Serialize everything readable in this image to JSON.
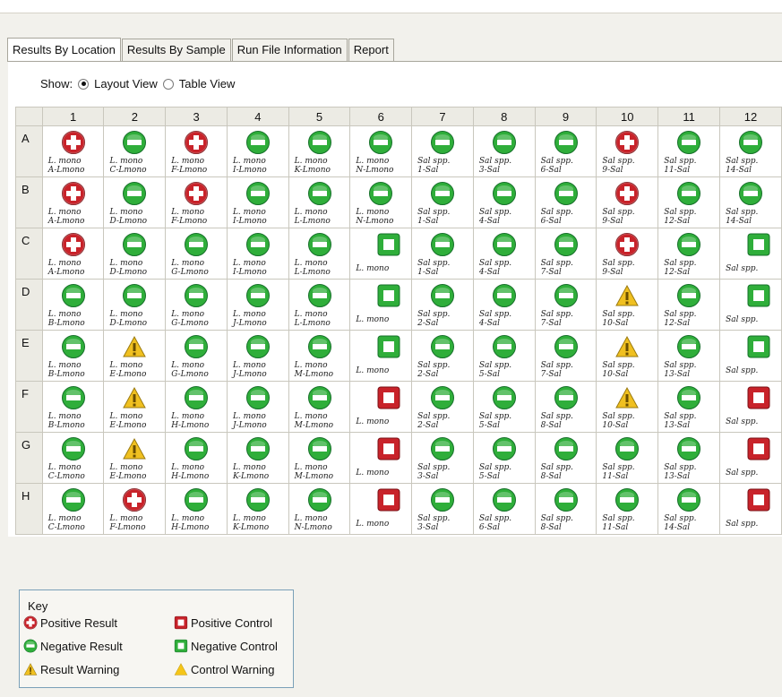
{
  "tabs": [
    "Results By Location",
    "Results By Sample",
    "Run File Information",
    "Report"
  ],
  "show": {
    "label": "Show:",
    "layout_view": "Layout View",
    "table_view": "Table View",
    "selected": "Layout View"
  },
  "columns": [
    "1",
    "2",
    "3",
    "4",
    "5",
    "6",
    "7",
    "8",
    "9",
    "10",
    "11",
    "12"
  ],
  "rows": [
    {
      "id": "A",
      "cells": [
        [
          "pos",
          "L. mono",
          "A-Lmono"
        ],
        [
          "neg",
          "L. mono",
          "C-Lmono"
        ],
        [
          "pos",
          "L. mono",
          "F-Lmono"
        ],
        [
          "neg",
          "L. mono",
          "I-Lmono"
        ],
        [
          "neg",
          "L. mono",
          "K-Lmono"
        ],
        [
          "neg",
          "L. mono",
          "N-Lmono"
        ],
        [
          "neg",
          "Sal spp.",
          "1-Sal"
        ],
        [
          "neg",
          "Sal spp.",
          "3-Sal"
        ],
        [
          "neg",
          "Sal spp.",
          "6-Sal"
        ],
        [
          "pos",
          "Sal spp.",
          "9-Sal"
        ],
        [
          "neg",
          "Sal spp.",
          "11-Sal"
        ],
        [
          "neg",
          "Sal spp.",
          "14-Sal"
        ]
      ]
    },
    {
      "id": "B",
      "cells": [
        [
          "pos",
          "L. mono",
          "A-Lmono"
        ],
        [
          "neg",
          "L. mono",
          "D-Lmono"
        ],
        [
          "pos",
          "L. mono",
          "F-Lmono"
        ],
        [
          "neg",
          "L. mono",
          "I-Lmono"
        ],
        [
          "neg",
          "L. mono",
          "L-Lmono"
        ],
        [
          "neg",
          "L. mono",
          "N-Lmono"
        ],
        [
          "neg",
          "Sal spp.",
          "1-Sal"
        ],
        [
          "neg",
          "Sal spp.",
          "4-Sal"
        ],
        [
          "neg",
          "Sal spp.",
          "6-Sal"
        ],
        [
          "pos",
          "Sal spp.",
          "9-Sal"
        ],
        [
          "neg",
          "Sal spp.",
          "12-Sal"
        ],
        [
          "neg",
          "Sal spp.",
          "14-Sal"
        ]
      ]
    },
    {
      "id": "C",
      "cells": [
        [
          "pos",
          "L. mono",
          "A-Lmono"
        ],
        [
          "neg",
          "L. mono",
          "D-Lmono"
        ],
        [
          "neg",
          "L. mono",
          "G-Lmono"
        ],
        [
          "neg",
          "L. mono",
          "I-Lmono"
        ],
        [
          "neg",
          "L. mono",
          "L-Lmono"
        ],
        [
          "negctrl",
          "L. mono",
          ""
        ],
        [
          "neg",
          "Sal spp.",
          "1-Sal"
        ],
        [
          "neg",
          "Sal spp.",
          "4-Sal"
        ],
        [
          "neg",
          "Sal spp.",
          "7-Sal"
        ],
        [
          "pos",
          "Sal spp.",
          "9-Sal"
        ],
        [
          "neg",
          "Sal spp.",
          "12-Sal"
        ],
        [
          "negctrl",
          "Sal spp.",
          ""
        ]
      ]
    },
    {
      "id": "D",
      "cells": [
        [
          "neg",
          "L. mono",
          "B-Lmono"
        ],
        [
          "neg",
          "L. mono",
          "D-Lmono"
        ],
        [
          "neg",
          "L. mono",
          "G-Lmono"
        ],
        [
          "neg",
          "L. mono",
          "J-Lmono"
        ],
        [
          "neg",
          "L. mono",
          "L-Lmono"
        ],
        [
          "negctrl",
          "L. mono",
          ""
        ],
        [
          "neg",
          "Sal spp.",
          "2-Sal"
        ],
        [
          "neg",
          "Sal spp.",
          "4-Sal"
        ],
        [
          "neg",
          "Sal spp.",
          "7-Sal"
        ],
        [
          "warn",
          "Sal spp.",
          "10-Sal"
        ],
        [
          "neg",
          "Sal spp.",
          "12-Sal"
        ],
        [
          "negctrl",
          "Sal spp.",
          ""
        ]
      ]
    },
    {
      "id": "E",
      "cells": [
        [
          "neg",
          "L. mono",
          "B-Lmono"
        ],
        [
          "warn",
          "L. mono",
          "E-Lmono"
        ],
        [
          "neg",
          "L. mono",
          "G-Lmono"
        ],
        [
          "neg",
          "L. mono",
          "J-Lmono"
        ],
        [
          "neg",
          "L. mono",
          "M-Lmono"
        ],
        [
          "negctrl",
          "L. mono",
          ""
        ],
        [
          "neg",
          "Sal spp.",
          "2-Sal"
        ],
        [
          "neg",
          "Sal spp.",
          "5-Sal"
        ],
        [
          "neg",
          "Sal spp.",
          "7-Sal"
        ],
        [
          "warn",
          "Sal spp.",
          "10-Sal"
        ],
        [
          "neg",
          "Sal spp.",
          "13-Sal"
        ],
        [
          "negctrl",
          "Sal spp.",
          ""
        ]
      ]
    },
    {
      "id": "F",
      "cells": [
        [
          "neg",
          "L. mono",
          "B-Lmono"
        ],
        [
          "warn",
          "L. mono",
          "E-Lmono"
        ],
        [
          "neg",
          "L. mono",
          "H-Lmono"
        ],
        [
          "neg",
          "L. mono",
          "J-Lmono"
        ],
        [
          "neg",
          "L. mono",
          "M-Lmono"
        ],
        [
          "posctrl",
          "L. mono",
          ""
        ],
        [
          "neg",
          "Sal spp.",
          "2-Sal"
        ],
        [
          "neg",
          "Sal spp.",
          "5-Sal"
        ],
        [
          "neg",
          "Sal spp.",
          "8-Sal"
        ],
        [
          "warn",
          "Sal spp.",
          "10-Sal"
        ],
        [
          "neg",
          "Sal spp.",
          "13-Sal"
        ],
        [
          "posctrl",
          "Sal spp.",
          ""
        ]
      ]
    },
    {
      "id": "G",
      "cells": [
        [
          "neg",
          "L. mono",
          "C-Lmono"
        ],
        [
          "warn",
          "L. mono",
          "E-Lmono"
        ],
        [
          "neg",
          "L. mono",
          "H-Lmono"
        ],
        [
          "neg",
          "L. mono",
          "K-Lmono"
        ],
        [
          "neg",
          "L. mono",
          "M-Lmono"
        ],
        [
          "posctrl",
          "L. mono",
          ""
        ],
        [
          "neg",
          "Sal spp.",
          "3-Sal"
        ],
        [
          "neg",
          "Sal spp.",
          "5-Sal"
        ],
        [
          "neg",
          "Sal spp.",
          "8-Sal"
        ],
        [
          "neg",
          "Sal spp.",
          "11-Sal"
        ],
        [
          "neg",
          "Sal spp.",
          "13-Sal"
        ],
        [
          "posctrl",
          "Sal spp.",
          ""
        ]
      ]
    },
    {
      "id": "H",
      "cells": [
        [
          "neg",
          "L. mono",
          "C-Lmono"
        ],
        [
          "pos",
          "L. mono",
          "F-Lmono"
        ],
        [
          "neg",
          "L. mono",
          "H-Lmono"
        ],
        [
          "neg",
          "L. mono",
          "K-Lmono"
        ],
        [
          "neg",
          "L. mono",
          "N-Lmono"
        ],
        [
          "posctrl",
          "L. mono",
          ""
        ],
        [
          "neg",
          "Sal spp.",
          "3-Sal"
        ],
        [
          "neg",
          "Sal spp.",
          "6-Sal"
        ],
        [
          "neg",
          "Sal spp.",
          "8-Sal"
        ],
        [
          "neg",
          "Sal spp.",
          "11-Sal"
        ],
        [
          "neg",
          "Sal spp.",
          "14-Sal"
        ],
        [
          "posctrl",
          "Sal spp.",
          ""
        ]
      ]
    }
  ],
  "key": {
    "title": "Key",
    "items": [
      {
        "type": "pos",
        "label": "Positive Result"
      },
      {
        "type": "neg",
        "label": "Negative Result"
      },
      {
        "type": "warn",
        "label": "Result Warning"
      },
      {
        "type": "posctrl",
        "label": "Positive Control"
      },
      {
        "type": "negctrl",
        "label": "Negative Control"
      },
      {
        "type": "ctrlwarn",
        "label": "Control Warning"
      }
    ]
  },
  "colors": {
    "positive": "#c8232a",
    "negative": "#2fae3a",
    "warning": "#f0c020",
    "control_warning": "#f5c518"
  }
}
